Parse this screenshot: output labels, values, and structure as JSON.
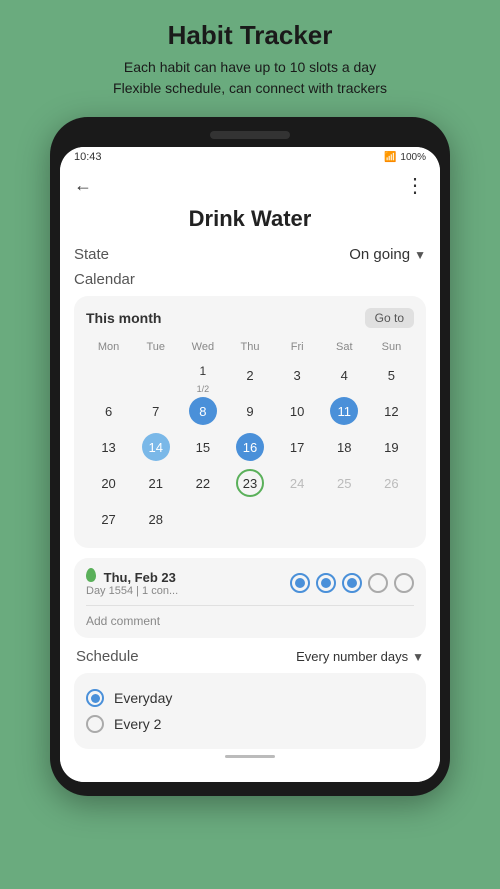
{
  "header": {
    "title": "Habit Tracker",
    "subtitle_line1": "Each habit can have up to 10 slots a day",
    "subtitle_line2": "Flexible schedule, can connect with trackers"
  },
  "status_bar": {
    "time": "10:43",
    "battery": "100%"
  },
  "top_nav": {
    "back": "←",
    "more": "⋮"
  },
  "habit": {
    "name": "Drink Water",
    "state_label": "State",
    "state_value": "On going",
    "calendar_label": "Calendar"
  },
  "calendar": {
    "month_label": "This month",
    "goto_label": "Go to",
    "day_headers": [
      "Mon",
      "Tue",
      "Wed",
      "Thu",
      "Fri",
      "Sat",
      "Sun"
    ],
    "rows": [
      [
        {
          "num": "",
          "type": "empty"
        },
        {
          "num": "",
          "type": "empty"
        },
        {
          "num": "1",
          "sub": "1/2",
          "type": "fraction"
        },
        {
          "num": "2",
          "type": "normal"
        },
        {
          "num": "3",
          "type": "normal"
        },
        {
          "num": "4",
          "type": "normal"
        },
        {
          "num": "5",
          "type": "normal"
        }
      ],
      [
        {
          "num": "6",
          "type": "normal"
        },
        {
          "num": "7",
          "type": "normal"
        },
        {
          "num": "8",
          "type": "filled-blue"
        },
        {
          "num": "9",
          "type": "normal"
        },
        {
          "num": "10",
          "type": "normal"
        },
        {
          "num": "11",
          "type": "filled-blue"
        },
        {
          "num": "12",
          "type": "normal"
        }
      ],
      [
        {
          "num": "13",
          "type": "normal"
        },
        {
          "num": "14",
          "type": "filled-blue-light"
        },
        {
          "num": "15",
          "type": "normal"
        },
        {
          "num": "16",
          "type": "filled-blue"
        },
        {
          "num": "17",
          "type": "normal"
        },
        {
          "num": "18",
          "type": "normal"
        },
        {
          "num": "19",
          "type": "normal"
        }
      ],
      [
        {
          "num": "20",
          "type": "normal"
        },
        {
          "num": "21",
          "type": "normal"
        },
        {
          "num": "22",
          "type": "normal"
        },
        {
          "num": "23",
          "type": "outlined"
        },
        {
          "num": "24",
          "type": "grayed"
        },
        {
          "num": "25",
          "type": "grayed"
        },
        {
          "num": "26",
          "type": "grayed"
        }
      ],
      [
        {
          "num": "27",
          "type": "normal"
        },
        {
          "num": "28",
          "type": "normal"
        },
        {
          "num": "",
          "type": "empty"
        },
        {
          "num": "",
          "type": "empty"
        },
        {
          "num": "",
          "type": "empty"
        },
        {
          "num": "",
          "type": "empty"
        },
        {
          "num": "",
          "type": "empty"
        }
      ]
    ]
  },
  "day_detail": {
    "date": "Thu, Feb 23",
    "sub": "Day 1554 | 1 con...",
    "add_comment": "Add comment",
    "circles": [
      "filled",
      "filled",
      "filled",
      "empty",
      "empty"
    ]
  },
  "schedule": {
    "label": "Schedule",
    "value": "Every number days",
    "options": [
      {
        "label": "Everyday",
        "selected": true
      },
      {
        "label": "Every 2",
        "selected": false
      }
    ]
  }
}
